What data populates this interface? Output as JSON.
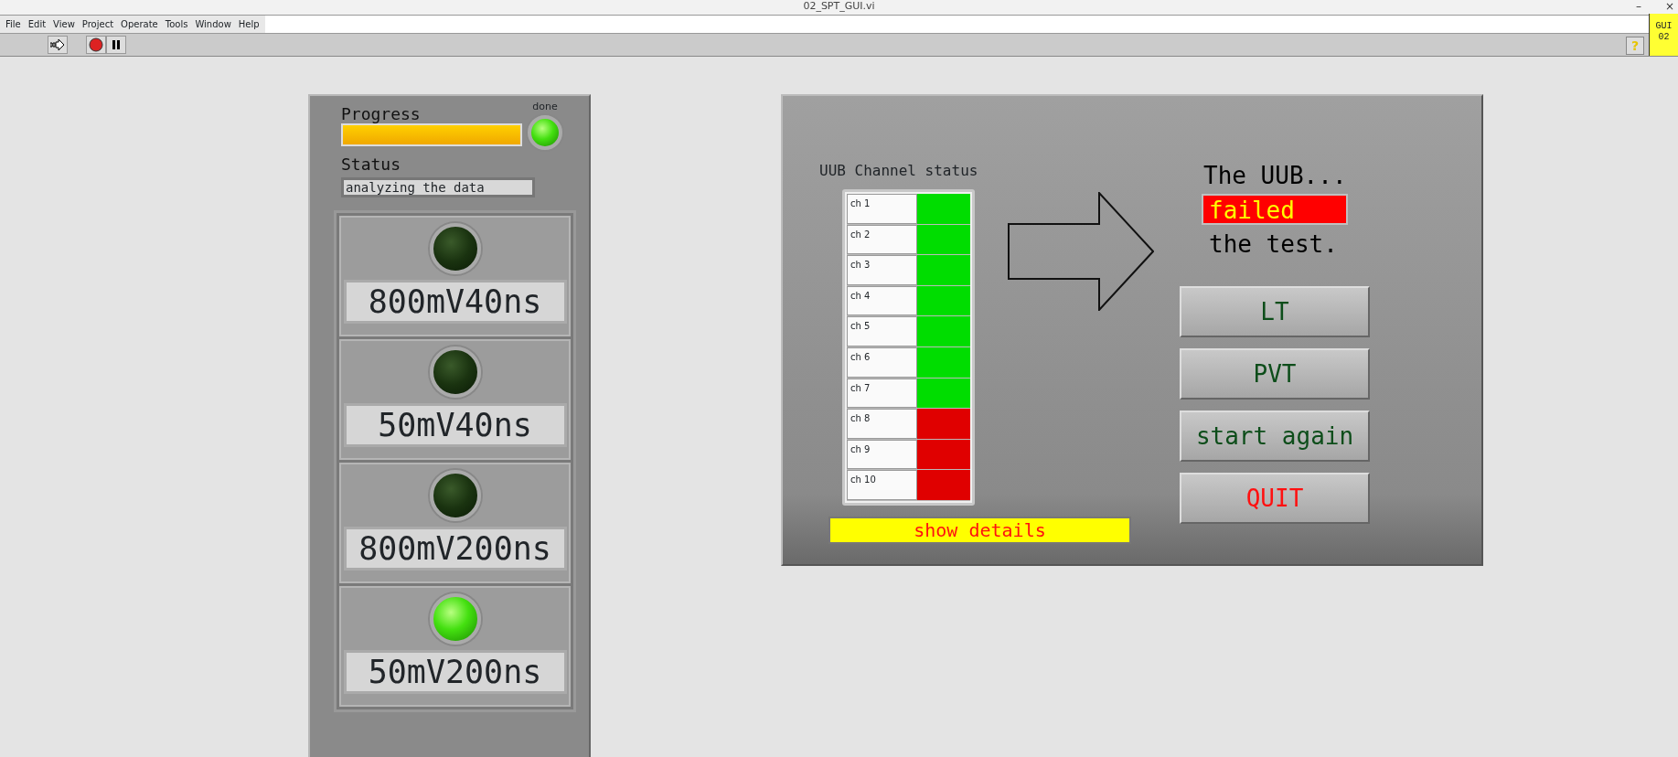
{
  "window": {
    "title": "02_SPT_GUI.vi",
    "controls": [
      "–",
      "×"
    ]
  },
  "menu": [
    "File",
    "Edit",
    "View",
    "Project",
    "Operate",
    "Tools",
    "Window",
    "Help"
  ],
  "toolbar": {
    "help": "?",
    "corner": [
      "GUI",
      "02"
    ]
  },
  "left_panel": {
    "progress_label": "Progress",
    "progress": {
      "level": 1.0
    },
    "done_label": "done",
    "done_on": true,
    "status_label": "Status",
    "status_value": "analyzing the data",
    "indicators": [
      {
        "label": "800mV40ns",
        "on": false
      },
      {
        "label": "50mV40ns",
        "on": false
      },
      {
        "label": "800mV200ns",
        "on": false
      },
      {
        "label": "50mV200ns",
        "on": true
      }
    ]
  },
  "right_panel": {
    "channel_title": "UUB Channel status",
    "channels": [
      {
        "name": "ch 1",
        "color": "#00dd00"
      },
      {
        "name": "ch 2",
        "color": "#00dd00"
      },
      {
        "name": "ch 3",
        "color": "#00dd00"
      },
      {
        "name": "ch 4",
        "color": "#00dd00"
      },
      {
        "name": "ch 5",
        "color": "#00dd00"
      },
      {
        "name": "ch 6",
        "color": "#00dd00"
      },
      {
        "name": "ch 7",
        "color": "#00dd00"
      },
      {
        "name": "ch 8",
        "color": "#e00000"
      },
      {
        "name": "ch 9",
        "color": "#e00000"
      },
      {
        "name": "ch 10",
        "color": "#e00000"
      }
    ],
    "details_button": "show details",
    "result_prefix": "The UUB...",
    "result": "failed",
    "result_suffix": "the test.",
    "buttons": [
      {
        "label": "LT",
        "kind": "normal"
      },
      {
        "label": "PVT",
        "kind": "normal"
      },
      {
        "label": "start again",
        "kind": "normal"
      },
      {
        "label": "QUIT",
        "kind": "quit"
      }
    ]
  }
}
